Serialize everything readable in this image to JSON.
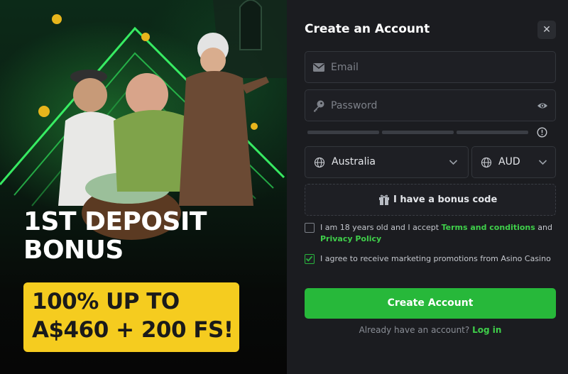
{
  "promo": {
    "headline_line1": "1ST DEPOSIT",
    "headline_line2": "BONUS",
    "offer_line1": "100% UP TO",
    "offer_line2": "A$460 + 200 FS!"
  },
  "form": {
    "title": "Create an Account",
    "close_icon": "close-icon",
    "email_placeholder": "Email",
    "password_placeholder": "Password",
    "country": "Australia",
    "currency": "AUD",
    "bonus_code_label": "I have a bonus code",
    "terms_prefix": "I am 18 years old and I accept ",
    "terms_link": "Terms and conditions",
    "terms_and": " and",
    "privacy_link": "Privacy Policy",
    "marketing_text": "I agree to receive marketing promotions from Asino Casino",
    "submit_label": "Create Account",
    "login_prompt": "Already have an account?",
    "login_link": "Log in"
  },
  "checkboxes": {
    "terms_checked": false,
    "marketing_checked": true
  },
  "colors": {
    "accent": "#27b83a",
    "bonus_box": "#f5cc1f",
    "background": "#1b1c20"
  }
}
